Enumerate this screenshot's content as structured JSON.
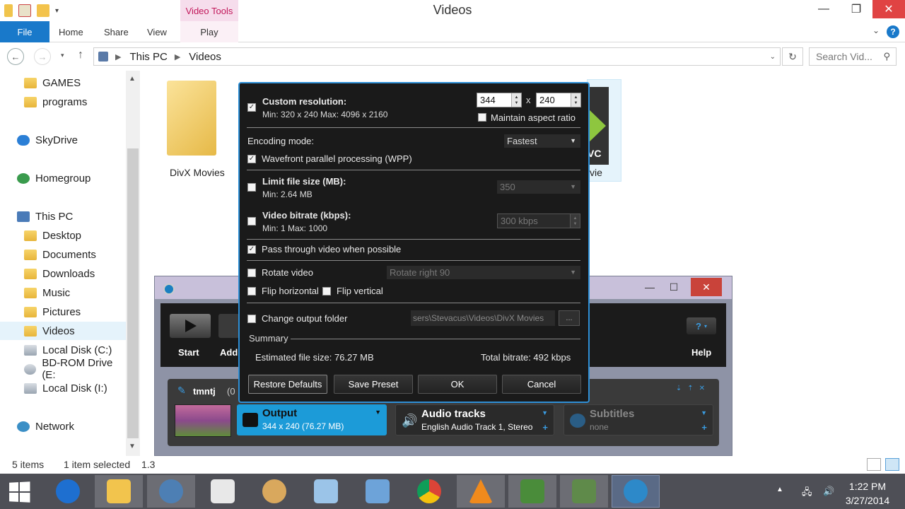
{
  "explorer": {
    "title": "Videos",
    "contextual_tab": "Video Tools",
    "ribbon_tabs": [
      "File",
      "Home",
      "Share",
      "View",
      "Play"
    ],
    "breadcrumb": [
      "This PC",
      "Videos"
    ],
    "search_placeholder": "Search Vid...",
    "nav_items": [
      {
        "label": "GAMES",
        "icon": "folder-icon"
      },
      {
        "label": "programs",
        "icon": "folder-icon"
      },
      {
        "label": "SkyDrive",
        "icon": "cloud-icon"
      },
      {
        "label": "Homegroup",
        "icon": "homegroup-icon"
      },
      {
        "label": "This PC",
        "icon": "computer-icon"
      },
      {
        "label": "Desktop",
        "icon": "folder-icon"
      },
      {
        "label": "Documents",
        "icon": "folder-icon"
      },
      {
        "label": "Downloads",
        "icon": "folder-icon"
      },
      {
        "label": "Music",
        "icon": "folder-icon"
      },
      {
        "label": "Pictures",
        "icon": "folder-icon"
      },
      {
        "label": "Videos",
        "icon": "folder-icon",
        "selected": true
      },
      {
        "label": "Local Disk (C:)",
        "icon": "drive-icon"
      },
      {
        "label": "BD-ROM Drive (E:",
        "icon": "disc-icon"
      },
      {
        "label": "Local Disk (I:)",
        "icon": "drive-icon"
      },
      {
        "label": "Network",
        "icon": "network-icon"
      }
    ],
    "files": [
      {
        "name": "DivX Movies"
      },
      {
        "name": "vie",
        "overlay_text": "VC"
      }
    ],
    "status": {
      "items": "5 items",
      "selected": "1 item selected",
      "size": "1.3"
    }
  },
  "divx_window": {
    "buttons": {
      "start": "Start",
      "add": "Add",
      "help": "Help",
      "help_glyph": "?"
    },
    "track_name": "tmntj",
    "track_time": "(0",
    "output": {
      "title": "Output",
      "sub": "344 x 240 (76.27 MB)"
    },
    "audio": {
      "title": "Audio tracks",
      "sub": "English Audio Track 1, Stereo"
    },
    "subtitles": {
      "title": "Subtitles",
      "sub": "none"
    }
  },
  "dialog": {
    "custom_resolution": {
      "label": "Custom resolution:",
      "sub": "Min: 320 x 240  Max: 4096 x 2160",
      "checked": true
    },
    "width": "344",
    "height": "240",
    "times": "x",
    "maintain_aspect": {
      "label": "Maintain aspect ratio",
      "checked": false
    },
    "encoding_mode": {
      "label": "Encoding mode:",
      "value": "Fastest"
    },
    "wpp": {
      "label": "Wavefront parallel processing (WPP)",
      "checked": true
    },
    "limit_size": {
      "label": "Limit file size (MB):",
      "sub": "Min: 2.64 MB",
      "value": "350",
      "checked": false
    },
    "bitrate": {
      "label": "Video bitrate (kbps):",
      "sub": "Min: 1   Max: 1000",
      "value": "300 kbps",
      "checked": false
    },
    "pass_through": {
      "label": "Pass through video when possible",
      "checked": true
    },
    "rotate": {
      "label": "Rotate video",
      "value": "Rotate right 90",
      "checked": false
    },
    "flip_h": {
      "label": "Flip horizontal",
      "checked": false
    },
    "flip_v": {
      "label": "Flip vertical",
      "checked": false
    },
    "output_folder": {
      "label": "Change output folder",
      "path": "sers\\Stevacus\\Videos\\DivX Movies",
      "browse": "...",
      "checked": false
    },
    "summary": {
      "title": "Summary",
      "est_size": "Estimated file size:  76.27 MB",
      "total_bitrate": "Total bitrate:  492 kbps"
    },
    "buttons": {
      "restore": "Restore Defaults",
      "save": "Save Preset",
      "ok": "OK",
      "cancel": "Cancel"
    }
  },
  "taskbar": {
    "apps": [
      "ie-lightning-icon",
      "file-explorer-icon",
      "globe-icon",
      "notepad-icon",
      "paint-icon",
      "keyboard-icon",
      "calculator-icon",
      "chrome-icon",
      "vlc-icon",
      "excel-icon",
      "app-icon",
      "divx-converter-icon"
    ],
    "time": "1:22 PM",
    "date": "3/27/2014"
  }
}
